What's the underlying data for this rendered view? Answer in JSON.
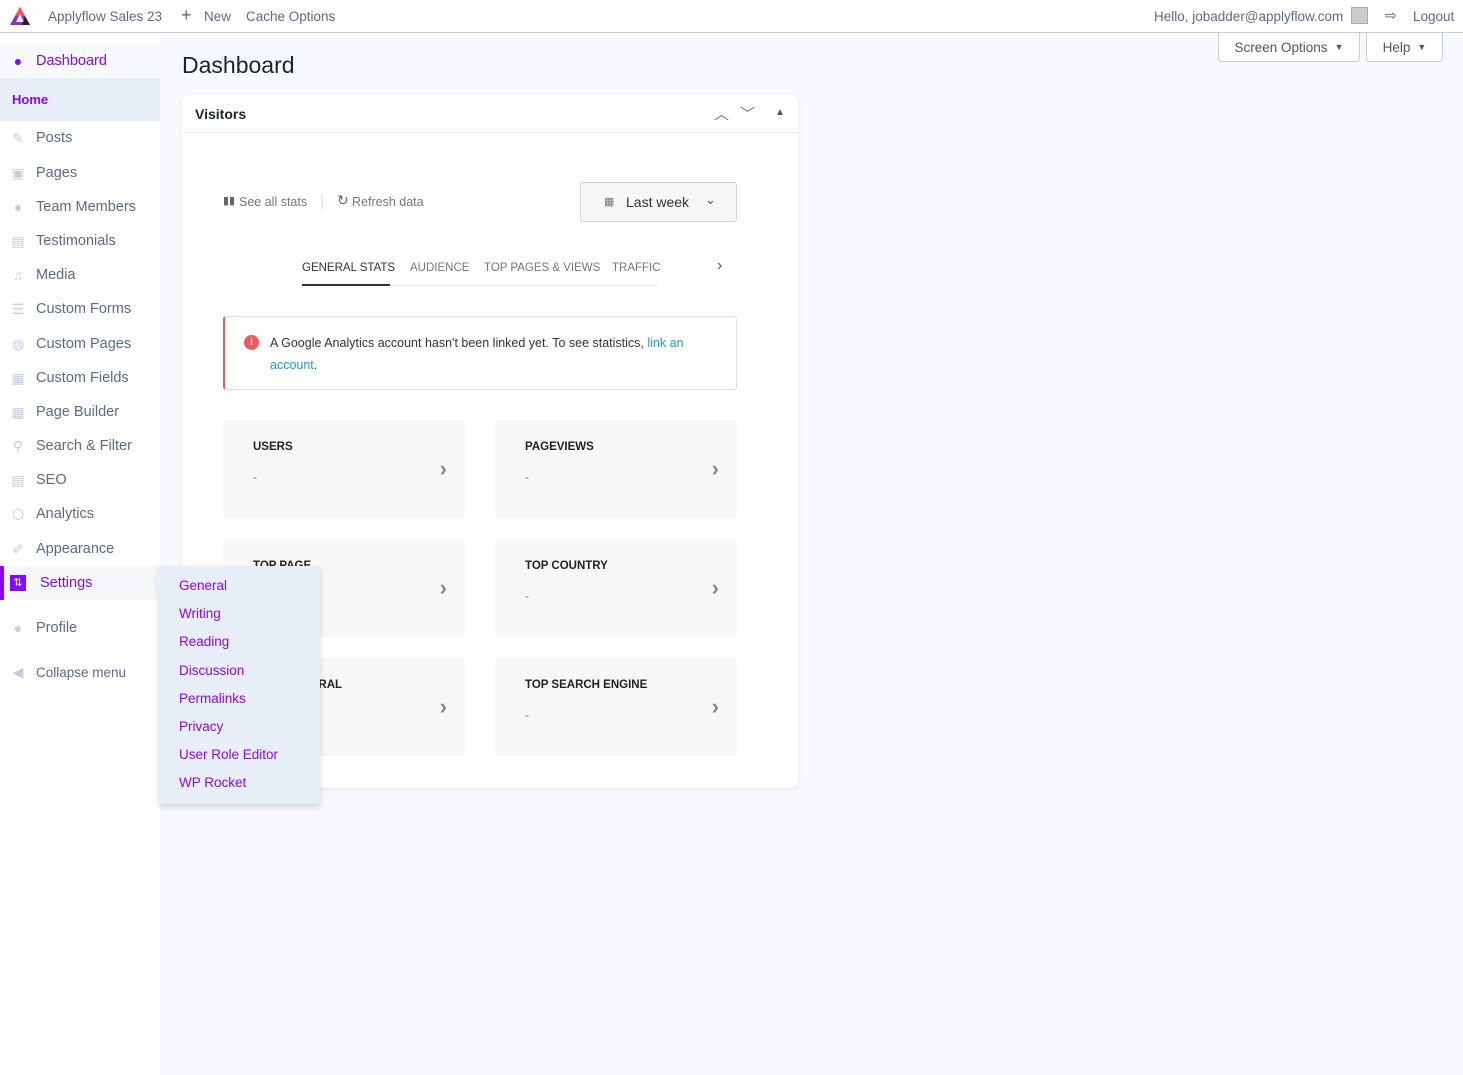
{
  "topbar": {
    "site_name": "Applyflow Sales 23",
    "new_label": "New",
    "cache_label": "Cache Options",
    "greeting": "Hello, jobadder@applyflow.com",
    "logout_label": "Logout"
  },
  "screen_options": "Screen Options",
  "help": "Help",
  "page_title": "Dashboard",
  "sidebar": {
    "dashboard": "Dashboard",
    "home": "Home",
    "items": [
      {
        "label": "Posts",
        "icon": "pin-icon"
      },
      {
        "label": "Pages",
        "icon": "pages-icon"
      },
      {
        "label": "Team Members",
        "icon": "user-icon"
      },
      {
        "label": "Testimonials",
        "icon": "comment-icon"
      },
      {
        "label": "Media",
        "icon": "media-icon"
      },
      {
        "label": "Custom Forms",
        "icon": "list-icon"
      },
      {
        "label": "Custom Pages",
        "icon": "globe-icon"
      },
      {
        "label": "Custom Fields",
        "icon": "table-icon"
      },
      {
        "label": "Page Builder",
        "icon": "table-icon"
      },
      {
        "label": "Search & Filter",
        "icon": "search-icon"
      },
      {
        "label": "SEO",
        "icon": "seo-icon"
      },
      {
        "label": "Analytics",
        "icon": "analytics-icon"
      },
      {
        "label": "Appearance",
        "icon": "brush-icon"
      },
      {
        "label": "Settings",
        "icon": "settings-icon"
      },
      {
        "label": "Profile",
        "icon": "user-icon"
      }
    ],
    "collapse": "Collapse menu"
  },
  "settings_submenu": [
    "General",
    "Writing",
    "Reading",
    "Discussion",
    "Permalinks",
    "Privacy",
    "User Role Editor",
    "WP Rocket"
  ],
  "widget": {
    "title": "Visitors",
    "see_all": "See all stats",
    "refresh": "Refresh data",
    "range": "Last week",
    "tabs": [
      "GENERAL STATS",
      "AUDIENCE",
      "TOP PAGES & VIEWS",
      "TRAFFIC"
    ],
    "notice": {
      "text": "A Google Analytics account hasn't been linked yet. To see statistics, ",
      "link": "link an account",
      "end": "."
    },
    "stats": [
      {
        "label": "USERS",
        "value": "-"
      },
      {
        "label": "PAGEVIEWS",
        "value": "-"
      },
      {
        "label": "TOP PAGE",
        "value": "-"
      },
      {
        "label": "TOP COUNTRY",
        "value": "-"
      },
      {
        "label": "TOP REFERRAL",
        "value": "-"
      },
      {
        "label": "TOP SEARCH ENGINE",
        "value": "-"
      }
    ]
  },
  "colors": {
    "accent": "#8a05ff",
    "link": "#1a9ad6",
    "error": "#f05a5a"
  }
}
